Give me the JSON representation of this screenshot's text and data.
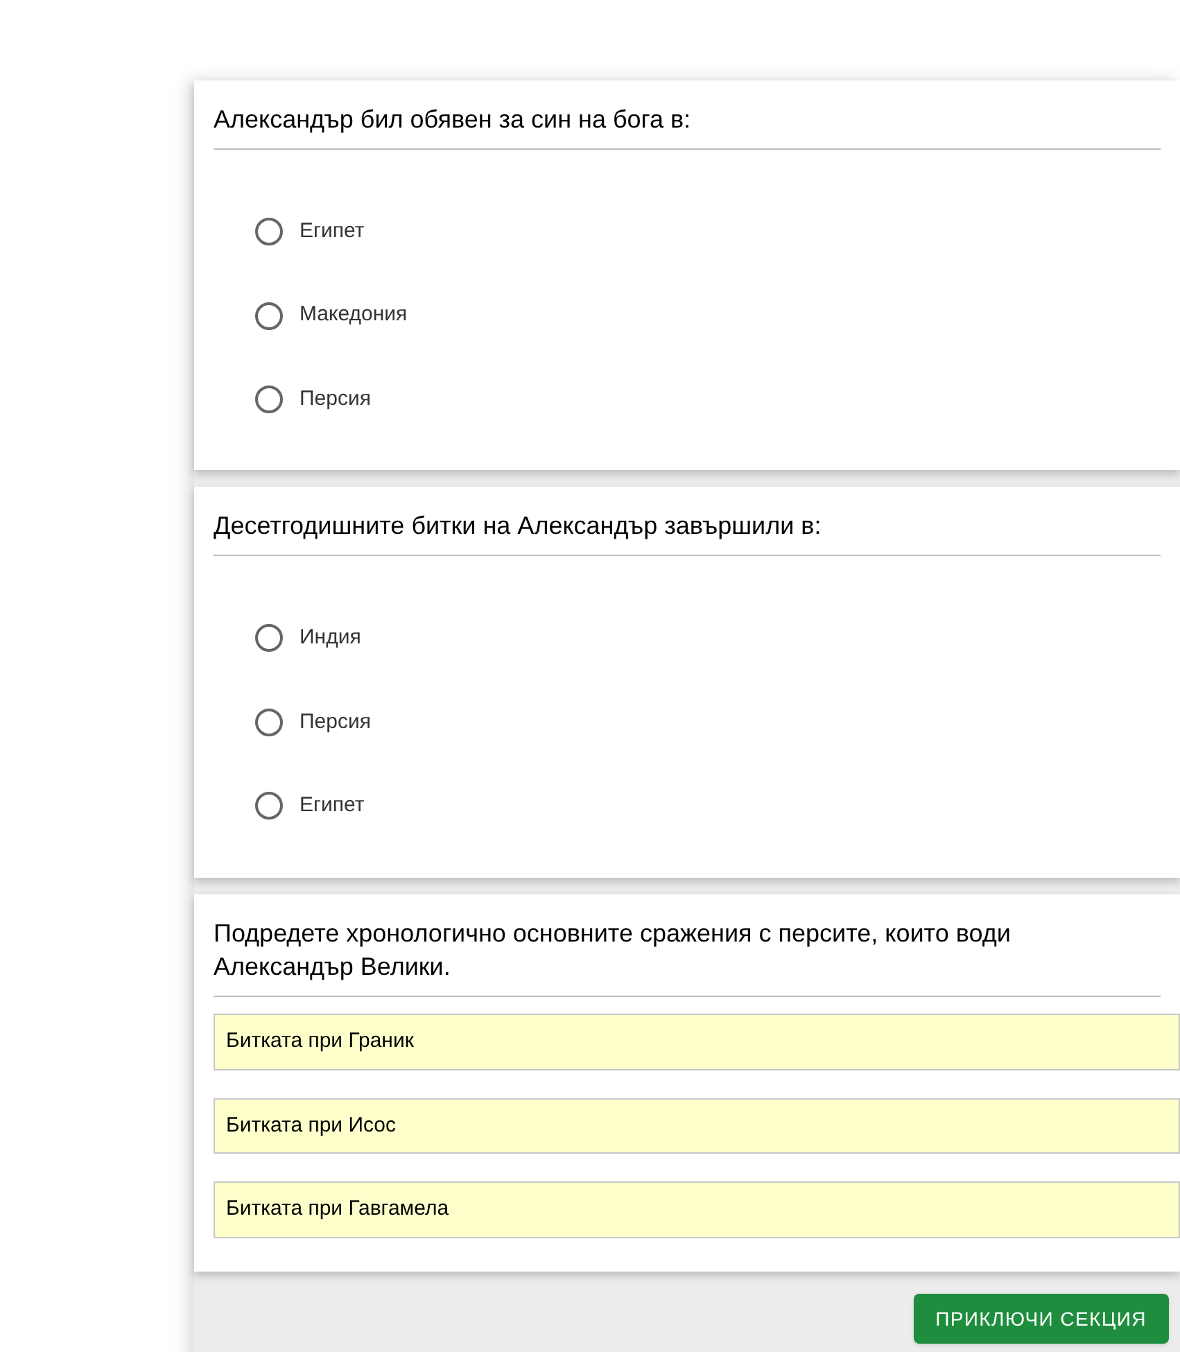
{
  "questions": [
    {
      "kind": "radio",
      "title": "Александър бил обявен за син на бога в:",
      "options": [
        {
          "label": "Египет",
          "selected": false
        },
        {
          "label": "Македония",
          "selected": false
        },
        {
          "label": "Персия",
          "selected": false
        }
      ]
    },
    {
      "kind": "radio",
      "title": "Десетгодишните битки на Александър завършили в:",
      "options": [
        {
          "label": "Индия",
          "selected": false
        },
        {
          "label": "Персия",
          "selected": false
        },
        {
          "label": "Египет",
          "selected": false
        }
      ]
    },
    {
      "kind": "order",
      "title": "Подредете хронологично основните сражения с персите, които води Александър Велики.",
      "items": [
        "Битката при Граник",
        "Битката при Исос",
        "Битката при Гавгамела"
      ]
    }
  ],
  "finish_button": "ПРИКЛЮЧИ СЕКЦИЯ"
}
